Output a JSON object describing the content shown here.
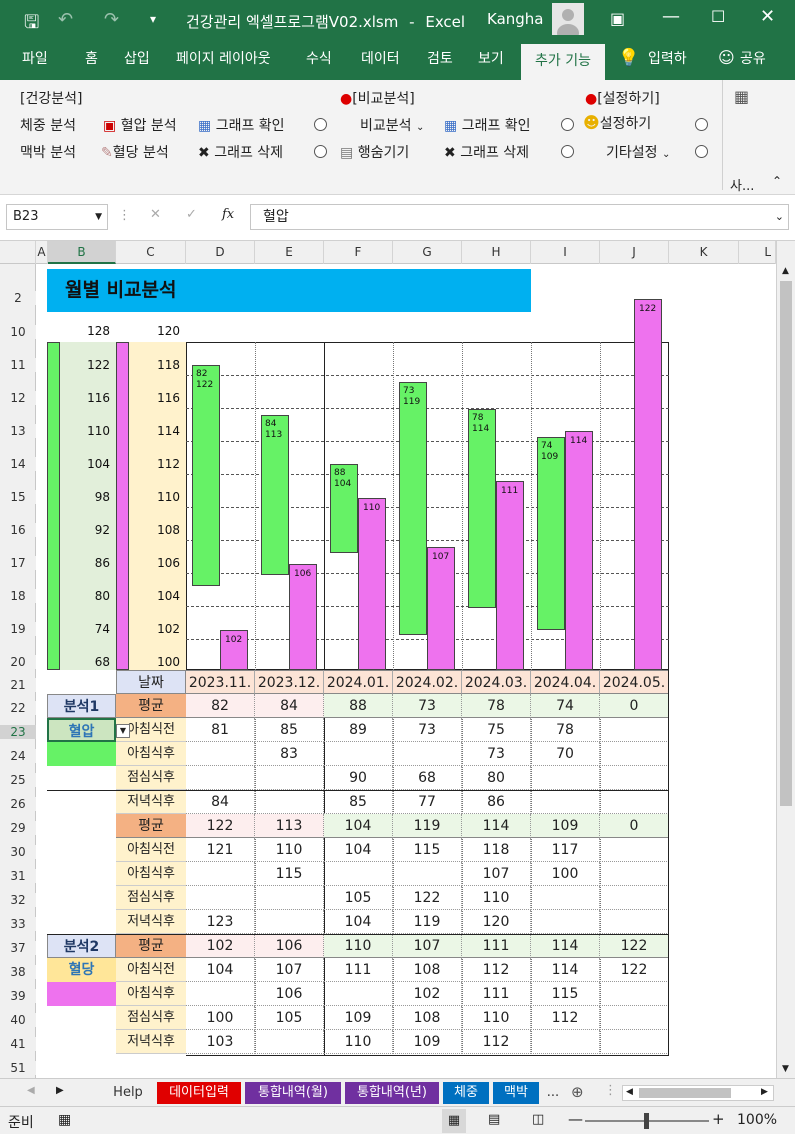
{
  "window": {
    "filename": "건강관리 엑셀프로그램V02.xlsm",
    "app": "Excel",
    "sep": "-",
    "user": "Kangha"
  },
  "tabs": [
    "파일",
    "홈",
    "삽입",
    "페이지 레이아웃",
    "수식",
    "데이터",
    "검토",
    "보기",
    "추가 기능"
  ],
  "tell_me": "입력하",
  "share": "공유",
  "ribbon": {
    "g1_title": "[건강분석]",
    "g2_title": "[비교분석]",
    "g3_title": "[설정하기]",
    "weight": "체중 분석",
    "bp": "혈압 분석",
    "graph_check": "그래프 확인",
    "pulse": "맥박 분석",
    "sugar": "혈당 분석",
    "graph_delete": "그래프 삭제",
    "compare": "비교분석",
    "hide_rows": "행숨기기",
    "settings": "설정하기",
    "other_settings": "기타설정",
    "collapsed": "사..."
  },
  "formula": {
    "namebox": "B23",
    "fx": "fx",
    "value": "혈압"
  },
  "columns": [
    "A",
    "B",
    "C",
    "D",
    "E",
    "F",
    "G",
    "H",
    "I",
    "J",
    "K",
    "L"
  ],
  "rows": [
    "2",
    "10",
    "11",
    "12",
    "13",
    "14",
    "15",
    "16",
    "17",
    "18",
    "19",
    "20",
    "21",
    "22",
    "23",
    "24",
    "25",
    "26",
    "29",
    "30",
    "31",
    "32",
    "33",
    "37",
    "38",
    "39",
    "40",
    "41",
    "51"
  ],
  "sheet": {
    "title": "월별 비교분석",
    "axis_left": [
      "128",
      "122",
      "116",
      "110",
      "104",
      "98",
      "92",
      "86",
      "80",
      "74",
      "68"
    ],
    "axis_right": [
      "120",
      "118",
      "116",
      "114",
      "112",
      "110",
      "108",
      "106",
      "104",
      "102",
      "100"
    ],
    "date_label": "날짜",
    "dates": [
      "2023.11.",
      "2023.12.",
      "2024.01.",
      "2024.02.",
      "2024.03.",
      "2024.04.",
      "2024.05."
    ],
    "analysis1": "분석1",
    "analysis1_value": "혈압",
    "analysis2": "분석2",
    "analysis2_value": "혈당",
    "avg_label": "평균",
    "sub_labels": [
      "아침식전",
      "아침식후",
      "점심식후",
      "저녁식후"
    ],
    "bp_high": {
      "avg": [
        "82",
        "84",
        "88",
        "73",
        "78",
        "74",
        "0"
      ],
      "rows": [
        [
          "81",
          "85",
          "89",
          "73",
          "75",
          "78",
          ""
        ],
        [
          "",
          "83",
          "",
          "",
          "73",
          "70",
          ""
        ],
        [
          "",
          "",
          "90",
          "68",
          "80",
          "",
          ""
        ],
        [
          "84",
          "",
          "85",
          "77",
          "86",
          "",
          ""
        ]
      ]
    },
    "bp_low": {
      "avg": [
        "122",
        "113",
        "104",
        "119",
        "114",
        "109",
        "0"
      ],
      "rows": [
        [
          "121",
          "110",
          "104",
          "115",
          "118",
          "117",
          ""
        ],
        [
          "",
          "115",
          "",
          "",
          "107",
          "100",
          ""
        ],
        [
          "",
          "",
          "105",
          "122",
          "110",
          "",
          ""
        ],
        [
          "123",
          "",
          "104",
          "119",
          "120",
          "",
          ""
        ]
      ]
    },
    "sugar": {
      "avg": [
        "102",
        "106",
        "110",
        "107",
        "111",
        "114",
        "122"
      ],
      "rows": [
        [
          "104",
          "107",
          "111",
          "108",
          "112",
          "114",
          "122"
        ],
        [
          "",
          "106",
          "",
          "102",
          "111",
          "115",
          ""
        ],
        [
          "100",
          "105",
          "109",
          "108",
          "110",
          "112",
          ""
        ],
        [
          "103",
          "",
          "110",
          "109",
          "112",
          "",
          ""
        ]
      ]
    }
  },
  "chart_data": {
    "type": "bar",
    "categories": [
      "2023.11.",
      "2023.12.",
      "2024.01.",
      "2024.02.",
      "2024.03.",
      "2024.04.",
      "2024.05."
    ],
    "series": [
      {
        "name": "혈압",
        "low": [
          82,
          84,
          88,
          73,
          78,
          74,
          0
        ],
        "high": [
          122,
          113,
          104,
          119,
          114,
          109,
          0
        ]
      },
      {
        "name": "혈당",
        "values": [
          102,
          106,
          110,
          107,
          111,
          114,
          122
        ]
      }
    ],
    "left_axis": [
      68,
      128
    ],
    "right_axis": [
      100,
      120
    ]
  },
  "sheet_tabs": [
    "Help",
    "데이터입력",
    "통합내역(월)",
    "통합내역(년)",
    "체중",
    "맥박",
    "..."
  ],
  "status": {
    "ready": "준비",
    "zoom": "100%"
  },
  "colors": {
    "excel_green": "#217346",
    "bar_green": "#66f266",
    "bar_magenta": "#ee72ee",
    "title_blue": "#00b0f0"
  }
}
